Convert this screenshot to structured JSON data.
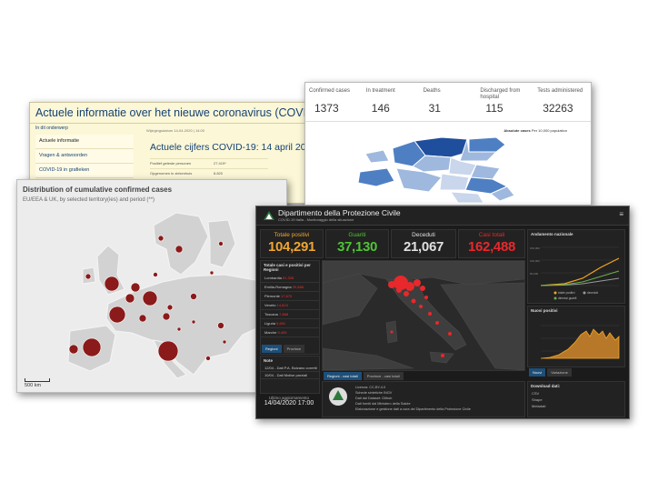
{
  "nl": {
    "title": "Actuele informatie over het nieuwe coronavirus (COVID-19)",
    "section_label": "In dit onderwerp",
    "nav_items": [
      "Actuele informatie",
      "Vragen & antwoorden",
      "COVID-19 in grafieken"
    ],
    "updated": "Wijzigingsdatum 14-04-2020 | 14:00",
    "heading": "Actuele cijfers COVID-19: 14 april 2020",
    "rows": [
      {
        "label": "Positief geteste personen",
        "value": "27.419*"
      },
      {
        "label": "Opgenomen in ziekenhuis",
        "value": "8.820"
      }
    ]
  },
  "ee": {
    "stats": [
      {
        "label": "Confirmed cases",
        "value": "1373"
      },
      {
        "label": "In treatment",
        "value": "146"
      },
      {
        "label": "Deaths",
        "value": "31"
      },
      {
        "label": "Discharged from hospital",
        "value": "115"
      },
      {
        "label": "Tests administered",
        "value": "32263"
      }
    ],
    "legend_title": "Absolute cases",
    "legend_sub": "Per 10,000 population",
    "colors": {
      "dark": "#1f4e9c",
      "mid": "#4f7fc3",
      "light": "#9fb8de",
      "pale": "#c9d6ec"
    }
  },
  "eu": {
    "title": "Distribution of cumulative confirmed cases",
    "subtitle": "EU/EEA & UK, by selected territory(ies) and period (**)",
    "scale": "500 km",
    "marker_color": "#8b1a1a"
  },
  "it": {
    "title": "Dipartimento della Protezione Civile",
    "subtitle": "COVID-19 Italia - Monitoraggio della situazione",
    "menu_icon": "≡",
    "kpis": [
      {
        "label": "Totale positivi",
        "value": "104,291",
        "color": "#f0a530"
      },
      {
        "label": "Guariti",
        "value": "37,130",
        "color": "#4fc437"
      },
      {
        "label": "Deceduti",
        "value": "21,067",
        "color": "#e0e0e0"
      },
      {
        "label": "Casi totali",
        "value": "162,488",
        "color": "#e8282b"
      }
    ],
    "regions_title": "Totale casi e positivi per Regioni",
    "regions": [
      {
        "name": "Lombardia",
        "value": "61,326"
      },
      {
        "name": "Emilia-Romagna",
        "value": "20,686"
      },
      {
        "name": "Piemonte",
        "value": "17,670"
      },
      {
        "name": "Veneto",
        "value": "14,624"
      },
      {
        "name": "Toscana",
        "value": "7,868"
      },
      {
        "name": "Liguria",
        "value": "5,691"
      },
      {
        "name": "Marche",
        "value": "5,405"
      }
    ],
    "region_tabs": [
      "Regioni",
      "Province"
    ],
    "map_tabs": [
      "Regioni - casi totali",
      "Province - casi totali"
    ],
    "notes_title": "Note",
    "notes": [
      "12/04 - Dati P.A. Bolzano corretti",
      "10/04 - Dati Molise parziali"
    ],
    "last_update_label": "Ultimo aggiornamento",
    "last_update": "14/04/2020 17:00",
    "license_lines": [
      "Licenza: CC-BY-4.0",
      "Schede sintetiche INGV",
      "Dati dal Dataset: Github",
      "Dati forniti dal Ministero della Salute",
      "Elaborazione e gestione dati a cura del Dipartimento della Protezione Civile"
    ],
    "trend_title": "Andamento nazionale",
    "trend_legend": [
      "totale positivi",
      "deceduti",
      "dimessi guariti"
    ],
    "trend_ticks": [
      "150,000",
      "100,000",
      "50,000"
    ],
    "new_title": "Nuovi positivi",
    "new_tabs": [
      "Nuovi",
      "Variazione"
    ],
    "download_title": "Download dati:",
    "download_items": [
      "CSV",
      "Shape",
      "Metadati"
    ],
    "colors": {
      "orange": "#f5a623",
      "red": "#e8282b",
      "grey": "#9a9a9a",
      "green": "#6ab04c"
    }
  }
}
